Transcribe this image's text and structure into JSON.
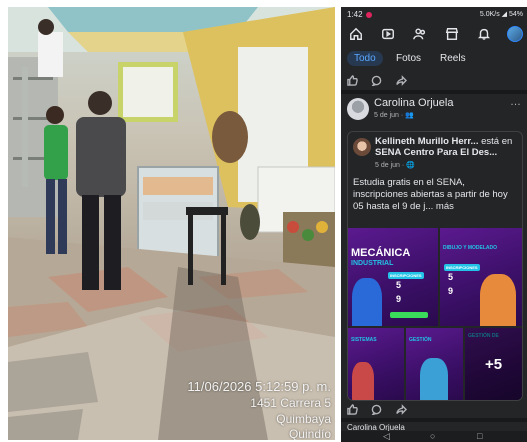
{
  "photo": {
    "timestamp": "11/06/2026 5:12:59 p. m.",
    "address": "1451 Carrera 5",
    "city": "Quimbaya",
    "city2": "Quindío"
  },
  "phone": {
    "status_time": "1:42",
    "status_right": "5.0K/s ◢ 54%",
    "tabs": [
      "Todo",
      "Fotos",
      "Reels"
    ],
    "active_tab": "Todo",
    "post": {
      "author": "Carolina Orjuela",
      "meta": "5 de jun · 👥",
      "more": "…",
      "shared": {
        "author": "Kellineth Murillo Herr...",
        "action": " está en ",
        "place": "SENA Centro Para El Des...",
        "meta": "5 de jun · 🌐",
        "text": "Estudia gratis en el  SENA, inscripciones abiertas a partir de hoy 05 hasta el 9 de j... más"
      },
      "flyers": {
        "main_title_1": "MECÁNICA",
        "main_title_2": "INDUSTRIAL",
        "top_right_title_1": "DIBUJO Y MODELADO",
        "badge": "INSCRIPCIONES",
        "nums": [
          "5",
          "9"
        ],
        "small_1": "SISTEMAS",
        "small_2": "GESTIÓN",
        "small_3": "GESTIÓN DE",
        "more_count": "+5"
      }
    },
    "next_post_author": "Carolina Orjuela"
  },
  "colors": {
    "fb_dark_bg": "#242526",
    "fb_tab_active_bg": "#263951",
    "fb_tab_active_text": "#5aa7ff",
    "flyer_purple": "#5b1a8f",
    "flyer_cyan": "#22c3e6"
  }
}
